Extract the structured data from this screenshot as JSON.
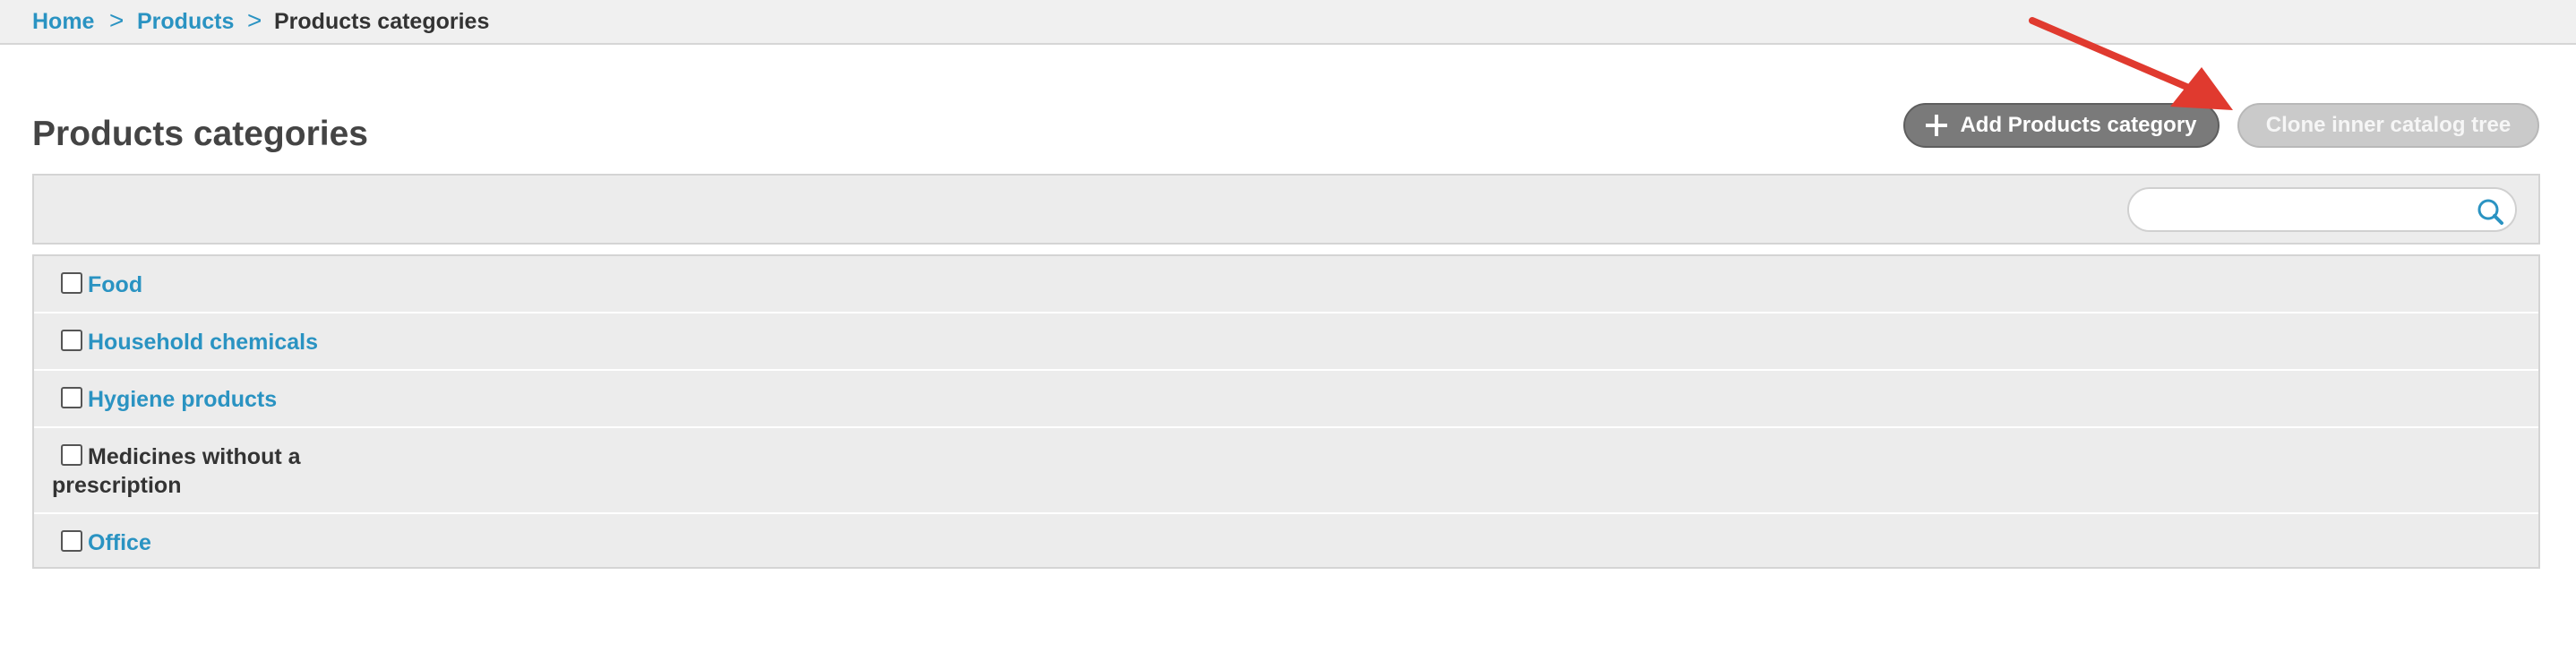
{
  "breadcrumb": {
    "items": [
      {
        "label": "Home"
      },
      {
        "label": "Products"
      },
      {
        "label": "Products categories"
      }
    ],
    "separator": ">"
  },
  "page": {
    "title": "Products categories"
  },
  "actions": {
    "add_label": "Add Products category",
    "clone_label": "Clone inner catalog tree"
  },
  "search": {
    "value": "",
    "placeholder": "",
    "icon": "search-icon"
  },
  "categories": [
    {
      "label": "Food",
      "is_link": true,
      "checked": false
    },
    {
      "label_line1": "Household chemicals",
      "is_link": true,
      "checked": false
    },
    {
      "label": "Hygiene products",
      "is_link": true,
      "checked": false
    },
    {
      "label_line1": "Medicines without a",
      "label_line2": "prescription",
      "is_link": false,
      "checked": false
    },
    {
      "label": "Office",
      "is_link": true,
      "checked": false
    }
  ],
  "colors": {
    "link": "#2a93c2",
    "text": "#333333",
    "annotation_arrow": "#e03a2f",
    "add_button": "#7a7a7a",
    "clone_button_disabled": "#cacaca"
  }
}
